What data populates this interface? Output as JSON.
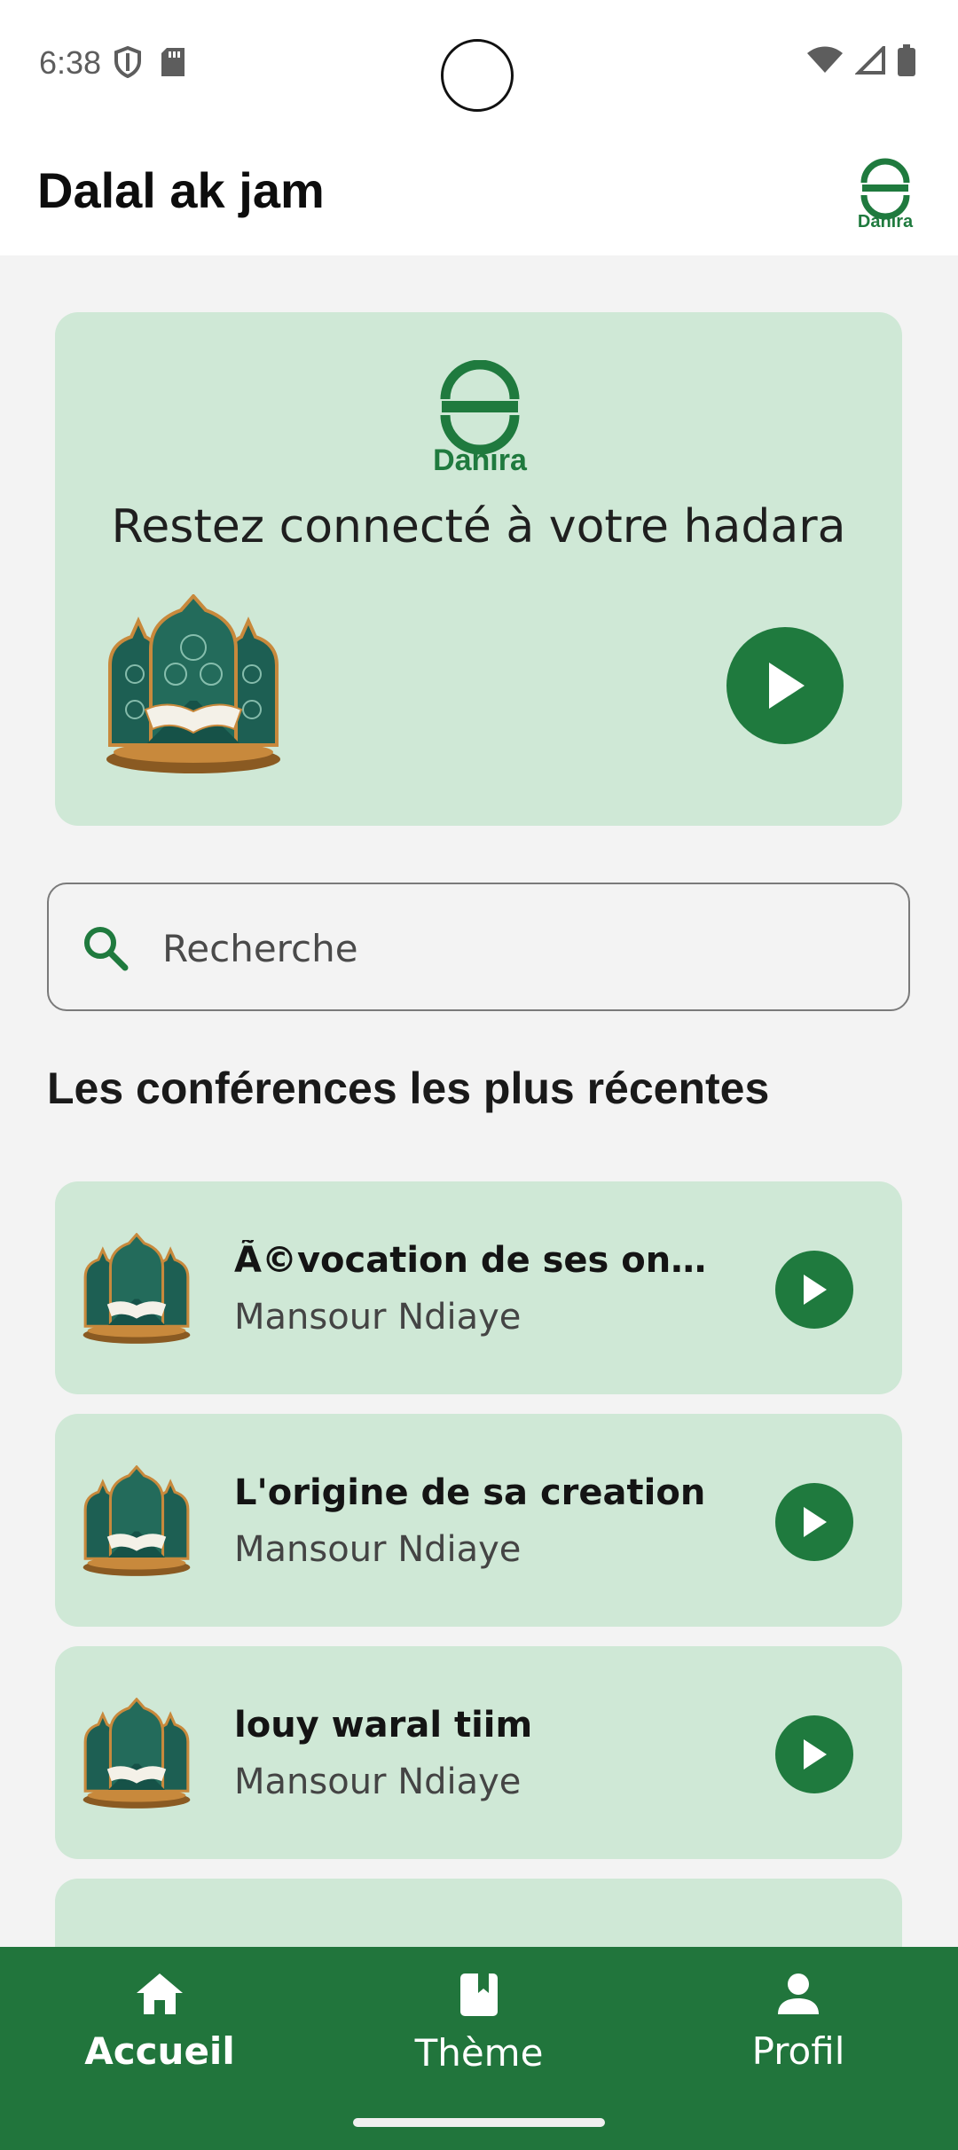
{
  "status_bar": {
    "time": "6:38",
    "left_icons": [
      "shield-icon",
      "sd-card-icon"
    ],
    "right_icons": [
      "wifi-icon",
      "signal-icon",
      "battery-icon"
    ]
  },
  "app_bar": {
    "title": "Dalal ak jam",
    "logo_text": "Dahira"
  },
  "hero": {
    "logo_text": "Dahira",
    "tagline": "Restez connecté à votre hadara"
  },
  "search": {
    "placeholder": "Recherche"
  },
  "section": {
    "title": "Les conférences les plus récentes"
  },
  "conferences": [
    {
      "title": "Ã©vocation de ses oncle…",
      "speaker": "Mansour Ndiaye"
    },
    {
      "title": "L'origine de sa creation",
      "speaker": "Mansour Ndiaye"
    },
    {
      "title": "louy waral tiim",
      "speaker": "Mansour Ndiaye"
    }
  ],
  "bottom_nav": {
    "items": [
      {
        "label": "Accueil",
        "icon": "home-icon",
        "active": true
      },
      {
        "label": "Thème",
        "icon": "book-icon",
        "active": false
      },
      {
        "label": "Profil",
        "icon": "person-icon",
        "active": false
      }
    ]
  },
  "colors": {
    "brand_green": "#1f7a3e",
    "card_bg": "#cfe8d6",
    "nav_bg": "#21753c"
  }
}
